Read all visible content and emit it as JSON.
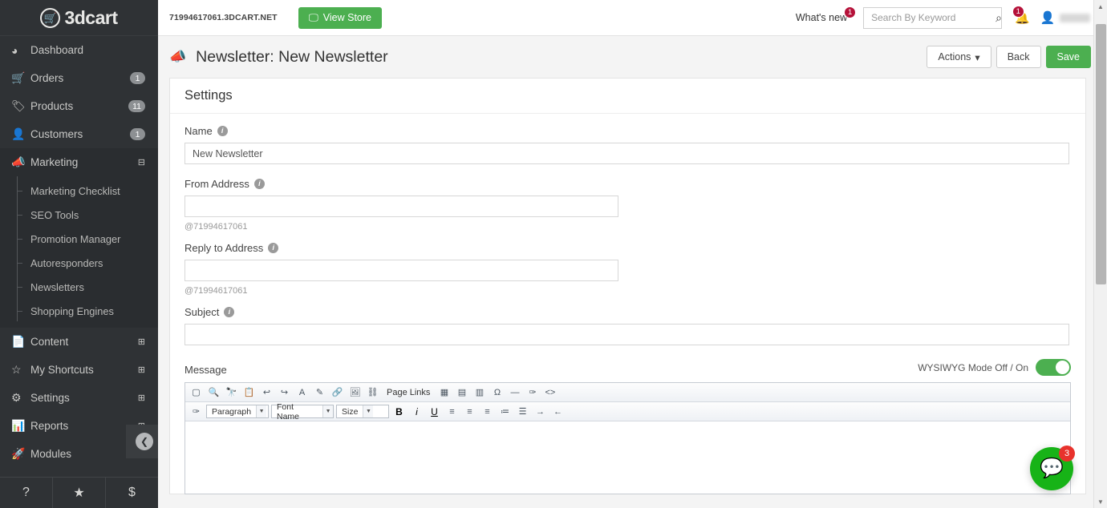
{
  "brand": {
    "logo_text": "3dcart",
    "logo_icon": "shopping-cart-icon",
    "accent_green": "#4CAF50",
    "accent_red": "#b51139",
    "sidebar_bg": "#2f3235"
  },
  "sidebar": {
    "items": [
      {
        "label": "Dashboard",
        "icon": "dashboard-icon",
        "glyph": "◕",
        "badge": "",
        "expand": ""
      },
      {
        "label": "Orders",
        "icon": "cart-icon",
        "glyph": "🛒",
        "badge": "1",
        "expand": ""
      },
      {
        "label": "Products",
        "icon": "tags-icon",
        "glyph": "🏷",
        "badge": "11",
        "expand": ""
      },
      {
        "label": "Customers",
        "icon": "user-icon",
        "glyph": "👤",
        "badge": "1",
        "expand": ""
      },
      {
        "label": "Marketing",
        "icon": "megaphone-icon",
        "glyph": "📣",
        "badge": "",
        "expand": "⊟",
        "active": true
      }
    ],
    "marketing_submenu": [
      {
        "label": "Marketing Checklist"
      },
      {
        "label": "SEO Tools"
      },
      {
        "label": "Promotion Manager"
      },
      {
        "label": "Autoresponders"
      },
      {
        "label": "Newsletters"
      },
      {
        "label": "Shopping Engines"
      }
    ],
    "items_after": [
      {
        "label": "Content",
        "icon": "document-icon",
        "glyph": "📄",
        "badge": "",
        "expand": "⊞"
      },
      {
        "label": "My Shortcuts",
        "icon": "star-icon",
        "glyph": "☆",
        "badge": "",
        "expand": "⊞"
      },
      {
        "label": "Settings",
        "icon": "gears-icon",
        "glyph": "⚙",
        "badge": "",
        "expand": "⊞"
      },
      {
        "label": "Reports",
        "icon": "bar-chart-icon",
        "glyph": "📊",
        "badge": "",
        "expand": "⊞"
      },
      {
        "label": "Modules",
        "icon": "rocket-icon",
        "glyph": "🚀",
        "badge": "",
        "expand": ""
      }
    ],
    "collapse_icon": "chevron-left-circle-icon",
    "collapse_glyph": "❮",
    "footer": [
      {
        "name": "help-icon",
        "glyph": "?"
      },
      {
        "name": "favorites-star-icon",
        "glyph": "★"
      },
      {
        "name": "billing-dollar-icon",
        "glyph": "$"
      }
    ]
  },
  "topbar": {
    "store_url": "71994617061.3DCART.NET",
    "view_store_label": "View Store",
    "view_store_icon": "monitor-icon",
    "whats_new_label": "What's new",
    "whats_new_count": "1",
    "search_placeholder": "Search By Keyword",
    "search_value": "",
    "search_icon": "search-icon",
    "bell_icon": "bell-icon",
    "bell_count": "1",
    "user_icon": "user-avatar-icon",
    "user_caret": "▾"
  },
  "pagehead": {
    "icon": "megaphone-icon",
    "title": "Newsletter: New Newsletter",
    "actions_label": "Actions",
    "actions_caret": "▾",
    "back_label": "Back",
    "save_label": "Save"
  },
  "card": {
    "title": "Settings",
    "fields": {
      "name": {
        "label": "Name",
        "value": "New Newsletter",
        "placeholder": "",
        "info_icon": "info-icon"
      },
      "from_address": {
        "label": "From Address",
        "value": "",
        "placeholder": "",
        "suffix": "@71994617061",
        "info_icon": "info-icon"
      },
      "reply_to_address": {
        "label": "Reply to Address",
        "value": "",
        "placeholder": "",
        "suffix": "@71994617061",
        "info_icon": "info-icon"
      },
      "subject": {
        "label": "Subject",
        "value": "",
        "placeholder": "",
        "info_icon": "info-icon"
      },
      "message": {
        "label": "Message",
        "wysiwyg_label": "WYSIWYG Mode Off / On",
        "wysiwyg_on": true,
        "content": ""
      }
    }
  },
  "editor_toolbar": {
    "row1": [
      {
        "name": "new-document-icon",
        "glyph": "▢"
      },
      {
        "name": "preview-icon",
        "glyph": "🔍"
      },
      {
        "name": "find-replace-icon",
        "glyph": "🔭"
      },
      {
        "name": "paste-icon",
        "glyph": "📋"
      },
      {
        "name": "undo-icon",
        "glyph": "↩"
      },
      {
        "name": "redo-icon",
        "glyph": "↪"
      },
      {
        "name": "text-color-icon",
        "glyph": "A"
      },
      {
        "name": "highlight-color-icon",
        "glyph": "✎"
      },
      {
        "name": "insert-link-icon",
        "glyph": "🔗"
      },
      {
        "name": "insert-image-icon",
        "glyph": "🖼"
      },
      {
        "name": "page-links-icon",
        "glyph": "⛓"
      },
      {
        "name": "page-links-label",
        "glyph": "Page Links",
        "is_label": true
      },
      {
        "name": "insert-table-icon",
        "glyph": "▦"
      },
      {
        "name": "table-properties-icon",
        "glyph": "▤"
      },
      {
        "name": "insert-form-icon",
        "glyph": "▥"
      },
      {
        "name": "special-character-icon",
        "glyph": "Ω"
      },
      {
        "name": "horizontal-rule-icon",
        "glyph": "—"
      },
      {
        "name": "clear-formatting-icon",
        "glyph": "✑"
      },
      {
        "name": "source-code-icon",
        "glyph": "<>"
      }
    ],
    "row2_icon": {
      "name": "edit-mode-icon",
      "glyph": "✑"
    },
    "selects": [
      {
        "name": "paragraph-format-select",
        "value": "Paragraph",
        "width": 62
      },
      {
        "name": "font-name-select",
        "value": "Font Name",
        "width": 62
      },
      {
        "name": "font-size-select",
        "value": "Size",
        "width": 56
      }
    ],
    "row2": [
      {
        "name": "bold-icon",
        "glyph": "B"
      },
      {
        "name": "italic-icon",
        "glyph": "i"
      },
      {
        "name": "underline-icon",
        "glyph": "U"
      },
      {
        "name": "align-left-icon",
        "glyph": "≡"
      },
      {
        "name": "align-center-icon",
        "glyph": "≡"
      },
      {
        "name": "align-right-icon",
        "glyph": "≡"
      },
      {
        "name": "ordered-list-icon",
        "glyph": "≔"
      },
      {
        "name": "unordered-list-icon",
        "glyph": "☰"
      },
      {
        "name": "indent-icon",
        "glyph": "→"
      },
      {
        "name": "outdent-icon",
        "glyph": "←"
      }
    ]
  },
  "chat": {
    "icon": "chat-bubble-icon",
    "glyph": "💬",
    "unread_count": "3"
  },
  "scrollbar": {
    "up_glyph": "▲",
    "down_glyph": "▼"
  }
}
